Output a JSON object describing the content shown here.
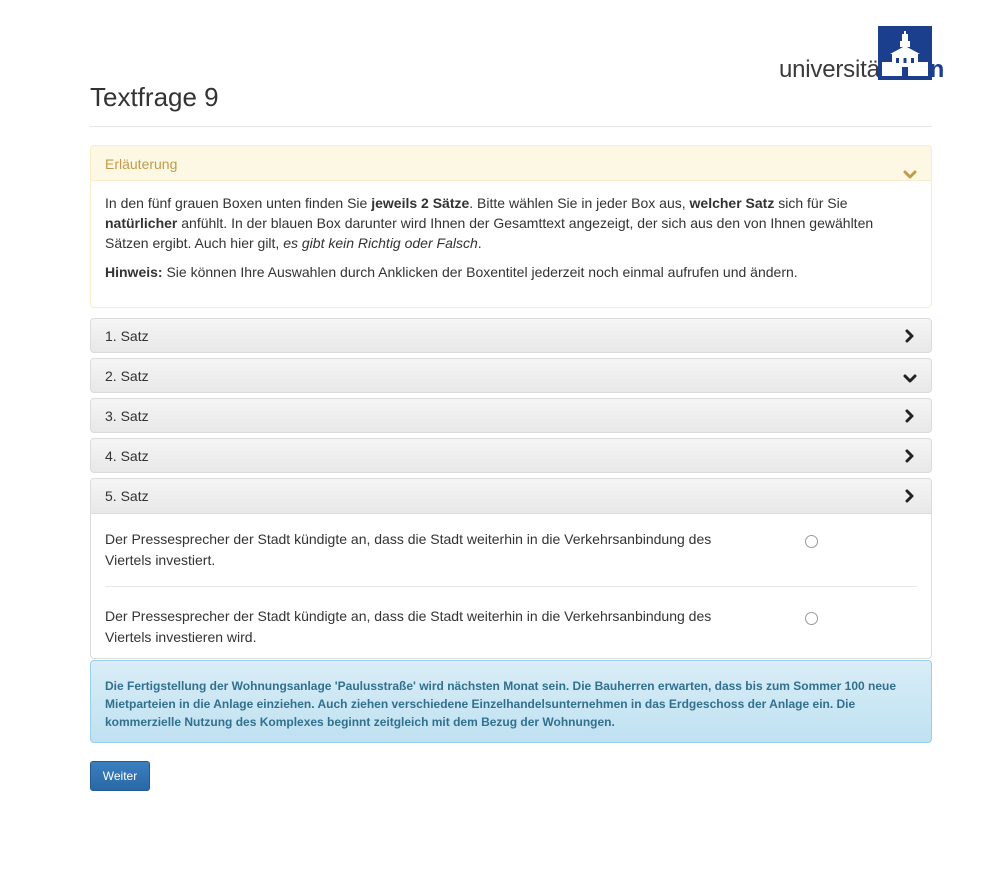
{
  "logo": {
    "text_part1": "universität",
    "text_part2": "bonn"
  },
  "page": {
    "title": "Textfrage 9"
  },
  "explanation": {
    "heading": "Erläuterung",
    "p1": {
      "t1": "In den fünf grauen Boxen unten finden Sie ",
      "b1": "jeweils 2 Sätze",
      "t2": ". Bitte wählen Sie in jeder Box aus, ",
      "b2": "welcher Satz",
      "t3": " sich für Sie ",
      "b3": "natürlicher",
      "t4": " anfühlt. In der blauen Box darunter wird Ihnen der Gesamttext angezeigt, der sich aus den von Ihnen gewählten Sätzen ergibt. Auch hier gilt, ",
      "i1": "es gibt kein Richtig oder Falsch",
      "t5": "."
    },
    "p2": {
      "b1": "Hinweis:",
      "t1": " Sie können Ihre Auswahlen durch Anklicken der Boxentitel jederzeit noch einmal aufrufen und ändern."
    }
  },
  "accordion": [
    {
      "title": "1. Satz"
    },
    {
      "title": "2. Satz"
    },
    {
      "title": "3. Satz"
    },
    {
      "title": "4. Satz"
    },
    {
      "title": "5. Satz"
    }
  ],
  "options": [
    {
      "text": "Der Pressesprecher der Stadt kündigte an, dass die Stadt weiterhin in die Verkehrsanbindung des Viertels investiert.",
      "selected": false
    },
    {
      "text": "Der Pressesprecher der Stadt kündigte an, dass die Stadt weiterhin in die Verkehrsanbindung des Viertels investieren wird.",
      "selected": false
    }
  ],
  "result_text": "Die Fertigstellung der Wohnungsanlage 'Paulusstraße' wird nächsten Monat sein. Die Bauherren erwarten, dass bis zum Sommer 100 neue Mietparteien in die Anlage einziehen. Auch ziehen verschiedene Einzelhandelsunternehmen in das Erdgeschoss der Anlage ein. Die kommerzielle Nutzung des Komplexes beginnt zeitgleich mit dem Bezug der Wohnungen.",
  "next_button": "Weiter",
  "colors": {
    "brand": "#1b3f8c",
    "primary": "#337ab7",
    "info_text": "#31708f",
    "warning_text": "#c39a4a"
  }
}
